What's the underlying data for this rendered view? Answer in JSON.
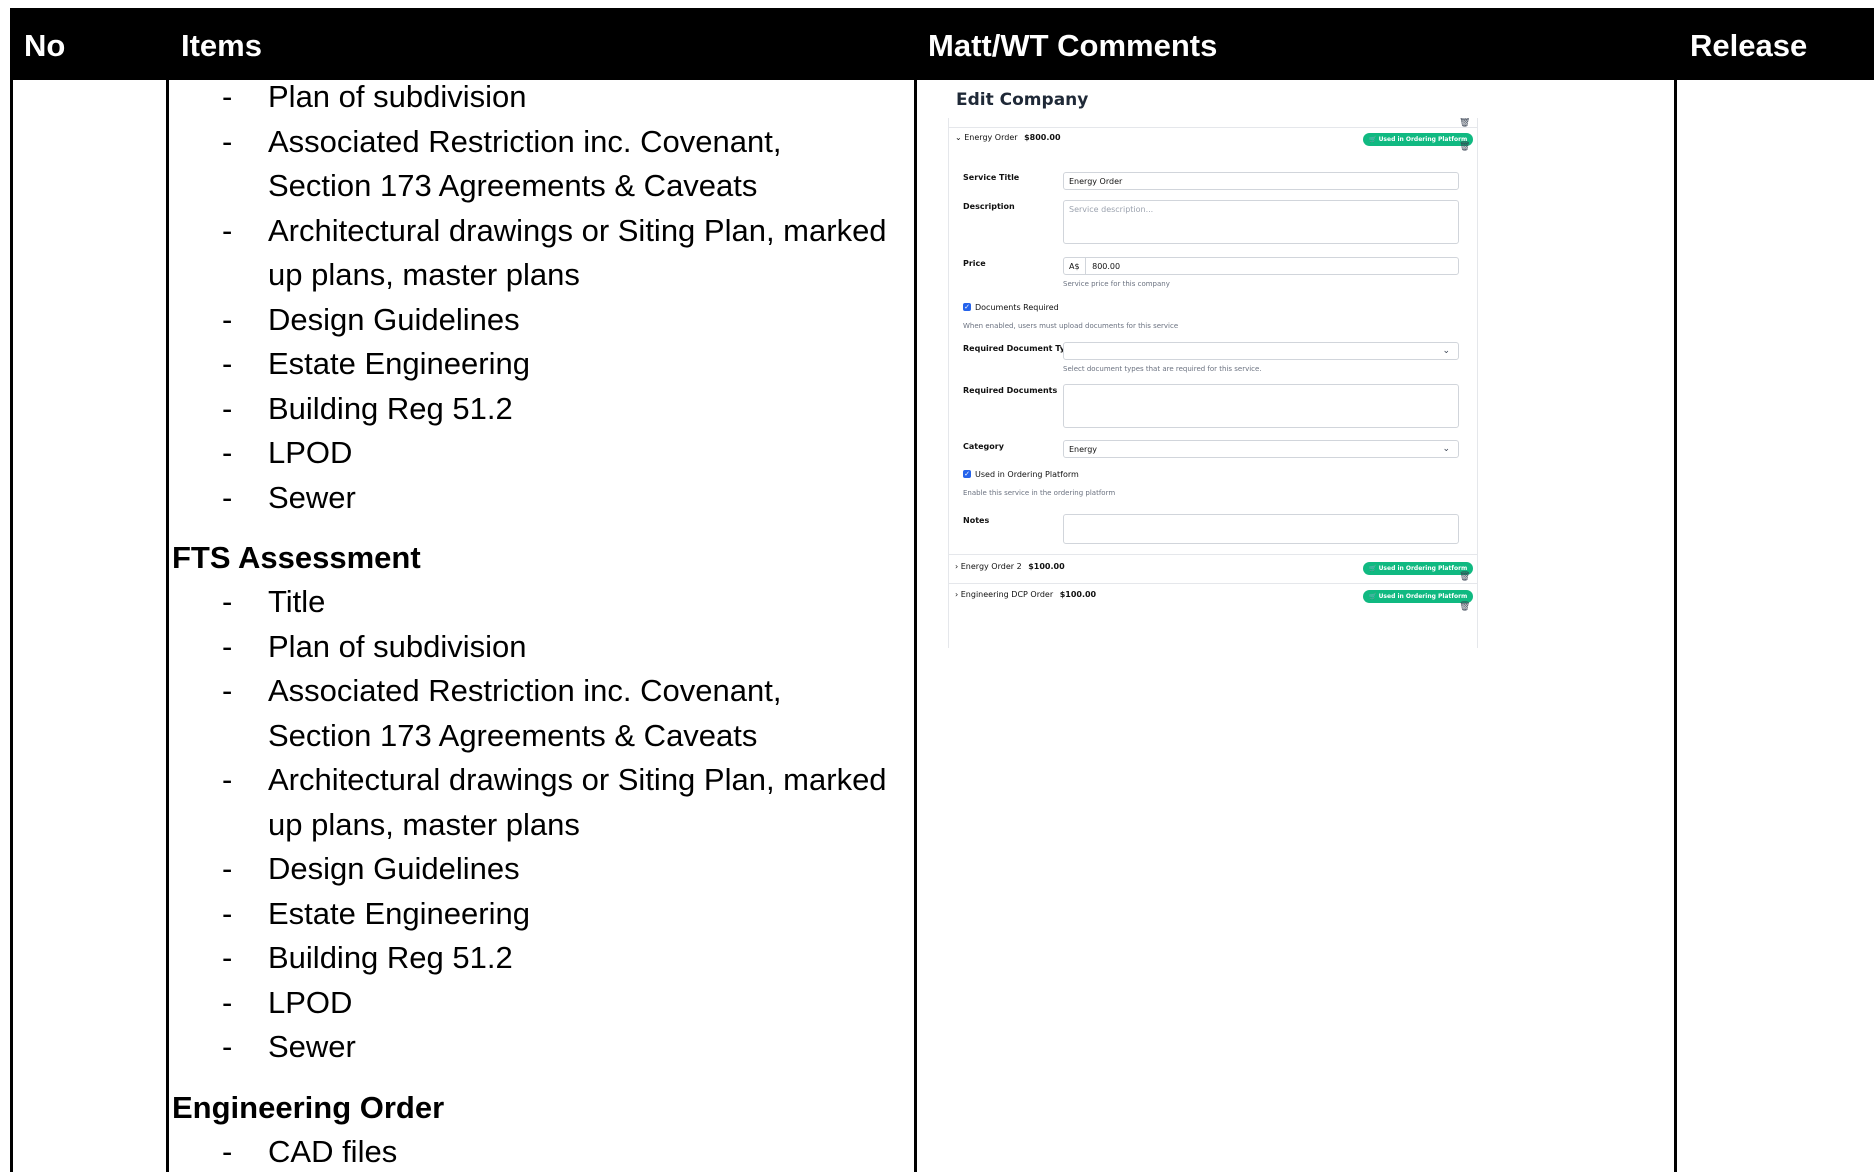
{
  "header": {
    "no": "No",
    "items": "Items",
    "comments": "Matt/WT Comments",
    "release": "Release"
  },
  "items": {
    "list_top": [
      "Plan of subdivision",
      "Associated Restriction inc. Covenant, Section 173 Agreements & Caveats",
      "Architectural drawings or Siting Plan, marked up plans, master plans",
      "Design Guidelines",
      "Estate Engineering",
      "Building Reg 51.2",
      "LPOD",
      "Sewer"
    ],
    "fts_title": "FTS Assessment",
    "fts_list": [
      "Title",
      "Plan of subdivision",
      "Associated Restriction inc. Covenant, Section 173 Agreements & Caveats",
      "Architectural drawings or Siting Plan, marked up plans, master plans",
      "Design Guidelines",
      "Estate Engineering",
      "Building Reg 51.2",
      "LPOD",
      "Sewer"
    ],
    "eng_title": "Engineering Order",
    "eng_list": [
      "CAD files"
    ]
  },
  "screenshot": {
    "title": "Edit Company",
    "service_name": "Energy Order",
    "service_price": "$800.00",
    "badge": "Used in Ordering Platform",
    "service_title_label": "Service Title",
    "service_title_value": "Energy Order",
    "description_label": "Description",
    "description_placeholder": "Service description...",
    "price_label": "Price",
    "price_currency": "A$",
    "price_value": "800.00",
    "price_hint": "Service price for this company",
    "docs_required_label": "Documents Required",
    "docs_required_hint": "When enabled, users must upload documents for this service",
    "req_doc_types_label": "Required Document Types",
    "req_doc_types_hint": "Select document types that are required for this service.",
    "req_docs_label": "Required Documents",
    "category_label": "Category",
    "category_value": "Energy",
    "used_label": "Used in Ordering Platform",
    "used_hint": "Enable this service in the ordering platform",
    "notes_label": "Notes",
    "service2_name": "Energy Order 2",
    "service2_price": "$100.00",
    "service3_name": "Engineering DCP Order",
    "service3_price": "$100.00"
  }
}
